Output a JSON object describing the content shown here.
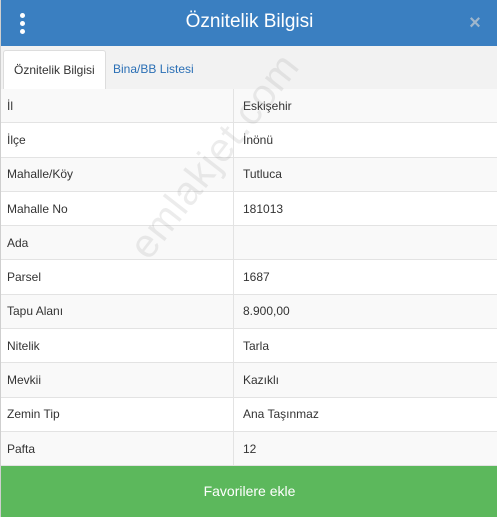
{
  "header": {
    "title": "Öznitelik Bilgisi",
    "close_label": "×"
  },
  "tabs": [
    {
      "label": "Öznitelik Bilgisi",
      "active": true
    },
    {
      "label": "Bina/BB Listesi",
      "active": false
    }
  ],
  "attributes": [
    {
      "key": "İl",
      "value": "Eskişehir"
    },
    {
      "key": "İlçe",
      "value": "İnönü"
    },
    {
      "key": "Mahalle/Köy",
      "value": "Tutluca"
    },
    {
      "key": "Mahalle No",
      "value": "181013"
    },
    {
      "key": "Ada",
      "value": ""
    },
    {
      "key": "Parsel",
      "value": "1687"
    },
    {
      "key": "Tapu Alanı",
      "value": "8.900,00"
    },
    {
      "key": "Nitelik",
      "value": "Tarla"
    },
    {
      "key": "Mevkii",
      "value": "Kazıklı"
    },
    {
      "key": "Zemin Tip",
      "value": "Ana Taşınmaz"
    },
    {
      "key": "Pafta",
      "value": "12"
    }
  ],
  "watermark": "emlakjet.com",
  "footer": {
    "button_label": "Favorilere ekle"
  },
  "colors": {
    "header": "#3a7fc1",
    "footer_button": "#5cb85c",
    "tab_link": "#2a6fb5"
  },
  "icons": {
    "menu": "vertical-dots-icon",
    "close": "close-icon"
  }
}
